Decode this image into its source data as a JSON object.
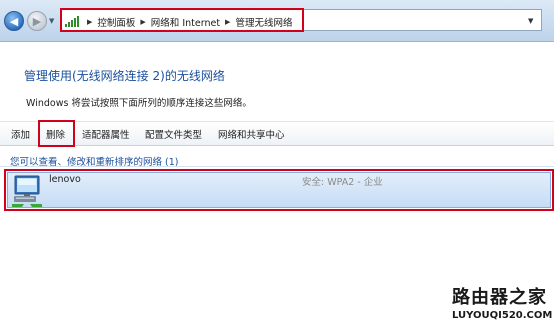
{
  "navigation": {
    "breadcrumbs": [
      "控制面板",
      "网络和 Internet",
      "管理无线网络"
    ]
  },
  "header": {
    "title": "管理使用(无线网络连接 2)的无线网络",
    "subtitle": "Windows 将尝试按照下面所列的顺序连接这些网络。"
  },
  "toolbar": {
    "add_label": "添加",
    "delete_label": "删除",
    "adapter_label": "适配器属性",
    "profile_type_label": "配置文件类型",
    "sharing_center_label": "网络和共享中心"
  },
  "networks": {
    "group_heading": "您可以查看、修改和重新排序的网络 (1)",
    "items": [
      {
        "name": "lenovo",
        "security": "安全: WPA2 - 企业"
      }
    ]
  },
  "watermark": {
    "main": "路由器之家",
    "sub": "LUYOUQI520.COM"
  },
  "colors": {
    "highlight_frame": "#d0011b",
    "title_blue": "#1b4f9c",
    "selection_fill": "#c6dcf5"
  }
}
